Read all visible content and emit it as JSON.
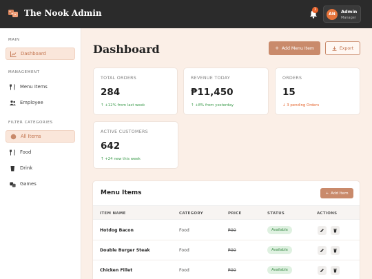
{
  "app": {
    "title": "The Nook Admin",
    "notifications_count": "1"
  },
  "user": {
    "initials": "AN",
    "name": "Admin",
    "role": "Manager"
  },
  "sidebar": {
    "sections": [
      {
        "title": "MAIN",
        "items": [
          {
            "label": "Dashboard",
            "icon": "chart-icon",
            "active": true
          }
        ]
      },
      {
        "title": "MANAGEMENT",
        "items": [
          {
            "label": "Menu Items",
            "icon": "utensils-icon"
          },
          {
            "label": "Employee",
            "icon": "users-icon"
          }
        ]
      },
      {
        "title": "FILTER CATEGORIES",
        "items": [
          {
            "label": "All Items",
            "icon": "circle-icon",
            "active": true
          },
          {
            "label": "Food",
            "icon": "utensils-icon"
          },
          {
            "label": "Drink",
            "icon": "cup-icon"
          },
          {
            "label": "Games",
            "icon": "dice-icon"
          }
        ]
      }
    ]
  },
  "main": {
    "title": "Dashboard",
    "add_menu_label": "Add Menu Item",
    "export_label": "Export"
  },
  "stats": [
    {
      "label": "TOTAL ORDERS",
      "value": "284",
      "sub": "+12% from last week",
      "tone": "up"
    },
    {
      "label": "REVENUE TODAY",
      "value": "₱11,450",
      "sub": "+8% from yesterday",
      "tone": "up"
    },
    {
      "label": "ORDERS",
      "value": "15",
      "sub": "3 pending Orders",
      "tone": "warn"
    },
    {
      "label": "ACTIVE CUSTOMERS",
      "value": "642",
      "sub": "+24 new this week",
      "tone": "up"
    }
  ],
  "menu": {
    "title": "Menu Items",
    "add_label": "Add Item",
    "columns": [
      "ITEM NAME",
      "CATEGORY",
      "PRICE",
      "STATUS",
      "ACTIONS"
    ],
    "rows": [
      {
        "name": "Hotdog Bacon",
        "category": "Food",
        "price": "₱99",
        "status": "Available"
      },
      {
        "name": "Double Burger Steak",
        "category": "Food",
        "price": "₱99",
        "status": "Available"
      },
      {
        "name": "Chicken Fillet",
        "category": "Food",
        "price": "₱99",
        "status": "Available"
      }
    ]
  },
  "colors": {
    "accent": "#c98a6b",
    "topbar": "#2b2b2b",
    "background": "#fbefe7",
    "success": "#3a9a4a",
    "warning": "#e5632a"
  }
}
